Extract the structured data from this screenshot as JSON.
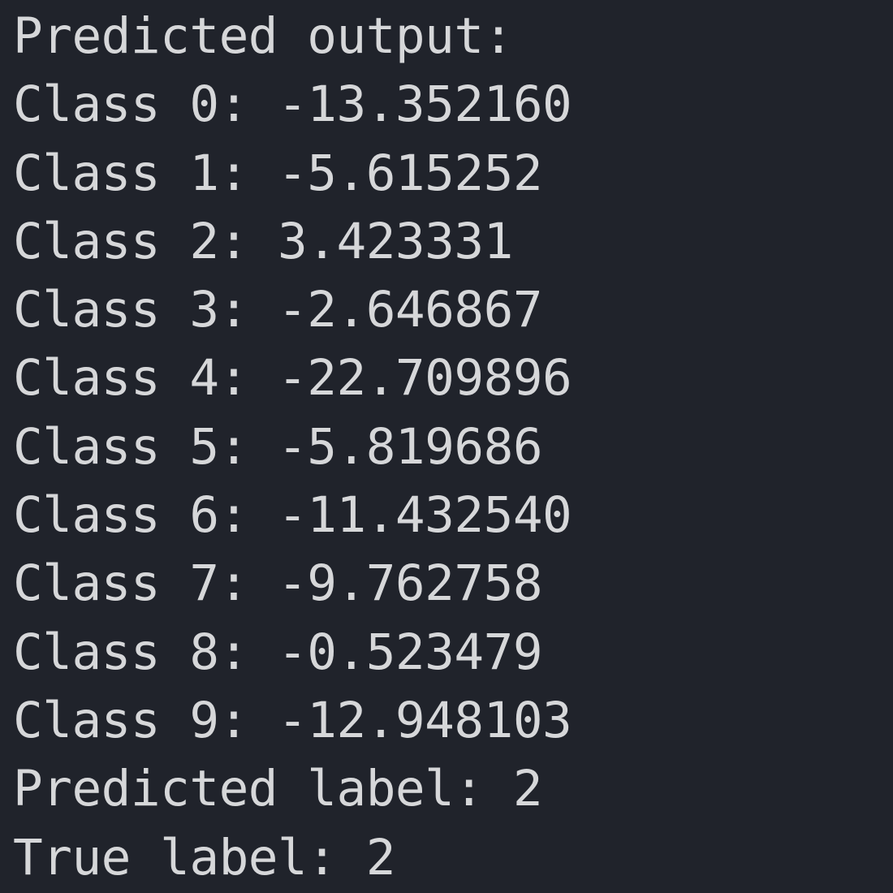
{
  "terminal": {
    "header": "Predicted output:",
    "class_lines": [
      "Class 0: -13.352160",
      "Class 1: -5.615252",
      "Class 2: 3.423331",
      "Class 3: -2.646867",
      "Class 4: -22.709896",
      "Class 5: -5.819686",
      "Class 6: -11.432540",
      "Class 7: -9.762758",
      "Class 8: -0.523479",
      "Class 9: -12.948103"
    ],
    "predicted_label_line": "Predicted label: 2",
    "true_label_line": "True label: 2"
  }
}
